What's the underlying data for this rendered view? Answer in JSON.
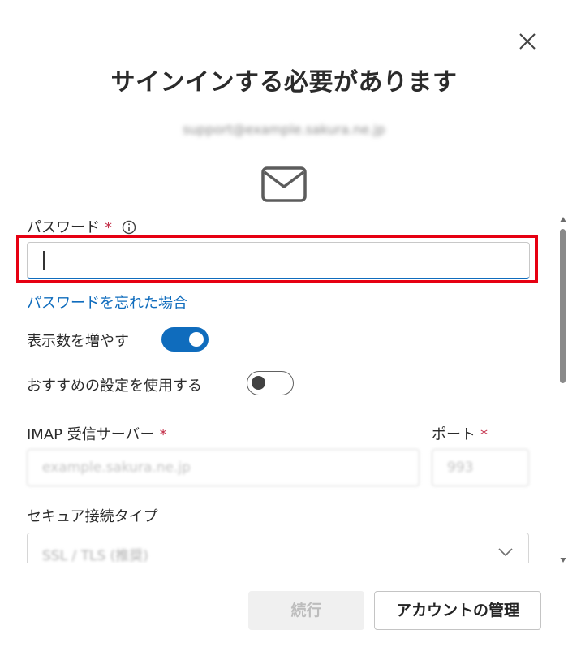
{
  "dialog": {
    "title": "サインインする必要があります",
    "email": "support@example.sakura.ne.jp",
    "close_icon": "close-icon",
    "mail_icon": "envelope-icon"
  },
  "password": {
    "label": "パスワード",
    "required_mark": "*",
    "info_icon": "info-icon",
    "value": "",
    "forgot_link": "パスワードを忘れた場合"
  },
  "toggles": {
    "show_more": {
      "label": "表示数を増やす",
      "state": "on"
    },
    "recommended": {
      "label": "おすすめの設定を使用する",
      "state": "off"
    }
  },
  "imap": {
    "label": "IMAP 受信サーバー",
    "required_mark": "*",
    "placeholder": "example.sakura.ne.jp"
  },
  "port": {
    "label": "ポート",
    "required_mark": "*",
    "placeholder": "993"
  },
  "security": {
    "label": "セキュア接続タイプ",
    "value": "SSL / TLS (推奨)"
  },
  "buttons": {
    "continue": "続行",
    "manage": "アカウントの管理"
  },
  "colors": {
    "accent": "#0f6cbd",
    "highlight": "#e60012",
    "required": "#c4314b"
  }
}
